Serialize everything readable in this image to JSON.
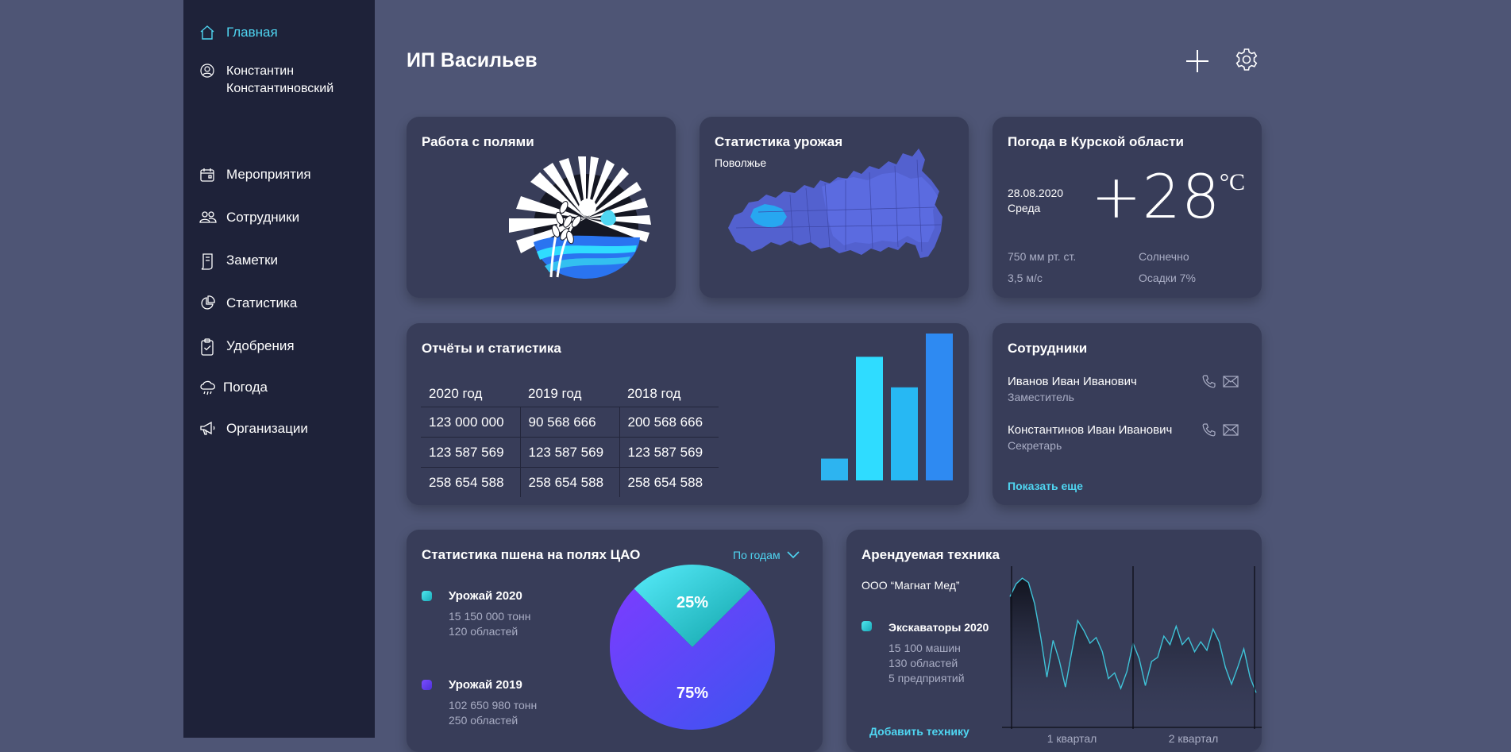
{
  "sidebar": {
    "home": "Главная",
    "user": [
      "Константин",
      "Константиновский"
    ],
    "items": [
      {
        "label": "Мероприятия",
        "icon": "calendar-icon"
      },
      {
        "label": "Сотрудники",
        "icon": "users-icon"
      },
      {
        "label": "Заметки",
        "icon": "notes-icon"
      },
      {
        "label": "Статистика",
        "icon": "pie-chart-icon"
      },
      {
        "label": "Удобрения",
        "icon": "clipboard-check-icon"
      },
      {
        "label": "Погода",
        "icon": "cloud-rain-icon"
      },
      {
        "label": "Организации",
        "icon": "megaphone-icon"
      }
    ]
  },
  "header": {
    "title": "ИП Васильев"
  },
  "fields": {
    "title": "Работа с полями"
  },
  "harvest": {
    "title": "Статистика урожая",
    "region": "Поволжье"
  },
  "weather": {
    "title": "Погода в Курской области",
    "date": "28.08.2020",
    "weekday": "Среда",
    "temp": "+28",
    "unit": "°C",
    "pressure": "750 мм рт. ст.",
    "wind": "3,5 м/с",
    "condition": "Солнечно",
    "precipitation": "Осадки 7%"
  },
  "reports": {
    "title": "Отчёты и статистика",
    "headers": [
      "2020 год",
      "2019 год",
      "2018 год"
    ],
    "rows": [
      [
        "123 000 000",
        "90 568 666",
        "200 568 666"
      ],
      [
        "123 587 569",
        "123 587 569",
        "123 587 569"
      ],
      [
        "258 654 588",
        "258 654 588",
        "258 654 588"
      ]
    ]
  },
  "chart_data": [
    {
      "type": "bar",
      "values": [
        15,
        85,
        64,
        101
      ],
      "ylim": [
        0,
        101
      ],
      "colors": [
        "#2db4f0",
        "#2fdcff",
        "#27b8f3",
        "#2e8af2"
      ]
    },
    {
      "type": "pie",
      "values": [
        25,
        75
      ],
      "labels": [
        "25%",
        "75%"
      ],
      "series_names": [
        "Урожай 2020",
        "Урожай 2019"
      ]
    },
    {
      "type": "area",
      "values": [
        8.3,
        9.2,
        9.6,
        9.3,
        7.8,
        5.4,
        2.6,
        5.2,
        3.8,
        1.9,
        4.3,
        6.6,
        5.9,
        5.0,
        5.4,
        4.4,
        2.5,
        2.9,
        1.8,
        3.0,
        5.0,
        3.9,
        2.0,
        3.7,
        4.0,
        5.5,
        4.9,
        6.2,
        4.9,
        5.4,
        4.4,
        5.1,
        4.5,
        6.0,
        5.1,
        3.3,
        2.1,
        3.3,
        4.6,
        2.6,
        1.5
      ],
      "x_labels": [
        "1 квартал",
        "2 квартал"
      ],
      "series_names": [
        "Экскаваторы 2020"
      ]
    }
  ],
  "employees": {
    "title": "Сотрудники",
    "list": [
      {
        "name": "Иванов Иван Иванович",
        "role": "Заместитель"
      },
      {
        "name": "Константинов Иван Иванович",
        "role": "Секретарь"
      }
    ],
    "more": "Показать еще"
  },
  "wheat": {
    "title": "Статистика пшена на полях ЦАО",
    "filter": "По годам",
    "legend": [
      {
        "title": "Урожай 2020",
        "lines": [
          "15 150 000 тонн",
          "120 областей"
        ],
        "color": "#22c6d8"
      },
      {
        "title": "Урожай 2019",
        "lines": [
          "102 650 980 тонн",
          "250 областей"
        ],
        "color": "#6a3df2"
      }
    ]
  },
  "equipment": {
    "title": "Арендуемая техника",
    "company": "ООО “Магнат Мед”",
    "legend": {
      "title": "Экскаваторы 2020",
      "lines": [
        "15 100 машин",
        "130 областей",
        "5 предприятий"
      ]
    },
    "add": "Добавить технику"
  },
  "colors": {
    "accent": "#4fd6f2",
    "sidebar": "#1e2239",
    "card": "#383d59",
    "background": "#4e5575"
  }
}
